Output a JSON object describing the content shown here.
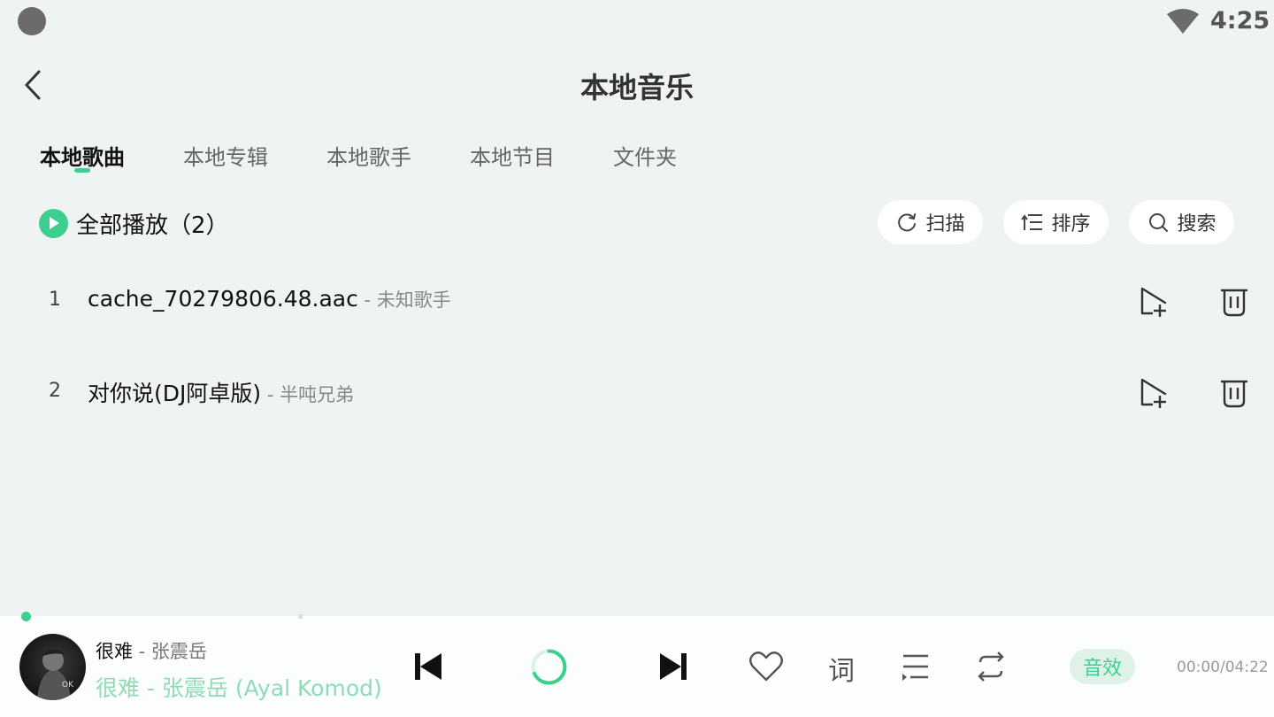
{
  "status_bar": {
    "time": "4:25",
    "wifi_icon": "wifi-icon"
  },
  "header": {
    "title": "本地音乐",
    "back_icon": "back-arrow-icon"
  },
  "tabs": [
    {
      "label": "本地歌曲",
      "active": true
    },
    {
      "label": "本地专辑",
      "active": false
    },
    {
      "label": "本地歌手",
      "active": false
    },
    {
      "label": "本地节目",
      "active": false
    },
    {
      "label": "文件夹",
      "active": false
    }
  ],
  "toolbar": {
    "play_all_label": "全部播放（2）",
    "scan_label": "扫描",
    "sort_label": "排序",
    "search_label": "搜索"
  },
  "songs": [
    {
      "index": "1",
      "title": "cache_70279806.48.aac",
      "artist": " - 未知歌手"
    },
    {
      "index": "2",
      "title": "对你说(DJ阿卓版)",
      "artist": " - 半吨兄弟"
    }
  ],
  "player": {
    "song": "很难",
    "artist": " - 张震岳",
    "subtitle": "很难 - 张震岳 (Ayal Komod)",
    "effect_label": "音效",
    "time": "00:00/04:22",
    "lyrics_label": "词",
    "progress_fraction": 0.0
  },
  "colors": {
    "accent": "#3ccf8e",
    "background": "#f0f3f4"
  }
}
